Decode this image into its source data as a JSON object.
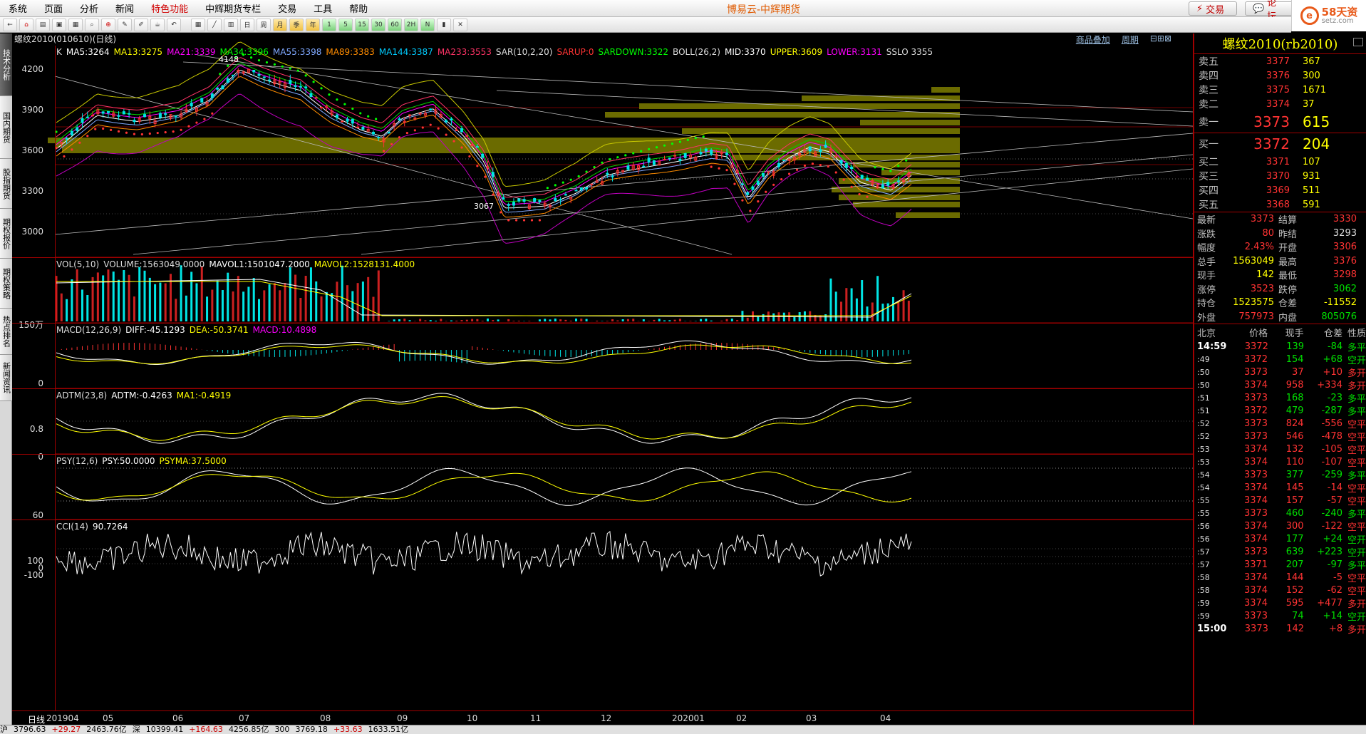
{
  "menu": {
    "items": [
      "系统",
      "页面",
      "分析",
      "新闻",
      "特色功能",
      "中辉期货专栏",
      "交易",
      "工具",
      "帮助"
    ],
    "highlight_index": 4,
    "title": "博易云-中辉期货",
    "trade_label": "交易",
    "forum_label": "论坛"
  },
  "logo": {
    "mark": "e",
    "text1": "58天资",
    "text2": "setz.com"
  },
  "toolbar": {
    "icons": [
      "back-icon",
      "home-icon",
      "book-icon",
      "folder-icon",
      "chart-icon",
      "search-icon",
      "zoom-in-icon",
      "pen-icon",
      "brush-icon",
      "cup-icon",
      "undo-icon",
      "table-icon",
      "line-icon",
      "grid-icon",
      "calendar-icon",
      "week-icon",
      "month-icon",
      "quarter-icon",
      "year-icon",
      "1min-icon",
      "5min-icon",
      "15min-icon",
      "30min-icon",
      "60min-icon",
      "2h-icon",
      "custom-icon",
      "bar-icon",
      "close-icon"
    ],
    "labels": [
      "←",
      "⌂",
      "▤",
      "▣",
      "▦",
      "⌕",
      "⊕",
      "✎",
      "✐",
      "☕",
      "↶",
      "▦",
      "╱",
      "▥",
      "日",
      "周",
      "月",
      "季",
      "年",
      "1",
      "5",
      "15",
      "30",
      "60",
      "2H",
      "N",
      "▮",
      "✕"
    ]
  },
  "sidebar": {
    "tabs": [
      "技术分析",
      "国内期货",
      "股指期货",
      "期权报价",
      "期权策略",
      "热点排名",
      "新闻资讯"
    ],
    "active_index": 0
  },
  "chart": {
    "header": "螺纹2010(010610)(日线)",
    "links": [
      "商品叠加",
      "周期"
    ],
    "xaxis": {
      "label": "日线",
      "ticks": [
        "201904",
        "05",
        "06",
        "07",
        "08",
        "09",
        "10",
        "11",
        "12",
        "202001",
        "02",
        "03",
        "04"
      ]
    },
    "main": {
      "legend": [
        {
          "t": "K",
          "c": "#dddddd"
        },
        {
          "t": "MA5:3264",
          "c": "#ffffff"
        },
        {
          "t": "MA13:3275",
          "c": "#ffff00"
        },
        {
          "t": "MA21:3339",
          "c": "#ff00ff"
        },
        {
          "t": "MA34:3396",
          "c": "#00ff00"
        },
        {
          "t": "MA55:3398",
          "c": "#7fa8ff"
        },
        {
          "t": "MA89:3383",
          "c": "#ff8c00"
        },
        {
          "t": "MA144:3387",
          "c": "#00ccff"
        },
        {
          "t": "MA233:3553",
          "c": "#ff3366"
        },
        {
          "t": "SAR(10,2,20)",
          "c": "#dddddd"
        },
        {
          "t": "SARUP:0",
          "c": "#ff3333"
        },
        {
          "t": "SARDOWN:3322",
          "c": "#00ff00"
        },
        {
          "t": "BOLL(26,2)",
          "c": "#dddddd"
        },
        {
          "t": "MID:3370",
          "c": "#ffffff"
        },
        {
          "t": "UPPER:3609",
          "c": "#ffff00"
        },
        {
          "t": "LOWER:3131",
          "c": "#ff00ff"
        },
        {
          "t": "SSLO 3355",
          "c": "#dddddd"
        }
      ],
      "yticks": [
        "4200",
        "3900",
        "3600",
        "3300",
        "3000"
      ],
      "annotations": [
        "4148",
        "3067"
      ]
    },
    "vol": {
      "legend": [
        {
          "t": "VOL(5,10)",
          "c": "#dddddd"
        },
        {
          "t": "VOLUME:1563049.0000",
          "c": "#dddddd"
        },
        {
          "t": "MAVOL1:1501047.2000",
          "c": "#ffffff"
        },
        {
          "t": "MAVOL2:1528131.4000",
          "c": "#ffff00"
        }
      ],
      "yticks": [
        "150万"
      ]
    },
    "macd": {
      "legend": [
        {
          "t": "MACD(12,26,9)",
          "c": "#dddddd"
        },
        {
          "t": "DIFF:-45.1293",
          "c": "#ffffff"
        },
        {
          "t": "DEA:-50.3741",
          "c": "#ffff00"
        },
        {
          "t": "MACD:10.4898",
          "c": "#ff00ff"
        }
      ],
      "yticks": [
        "0"
      ]
    },
    "adtm": {
      "legend": [
        {
          "t": "ADTM(23,8)",
          "c": "#dddddd"
        },
        {
          "t": "ADTM:-0.4263",
          "c": "#ffffff"
        },
        {
          "t": "MA1:-0.4919",
          "c": "#ffff00"
        }
      ],
      "yticks": [
        "0.8",
        "0"
      ]
    },
    "psy": {
      "legend": [
        {
          "t": "PSY(12,6)",
          "c": "#dddddd"
        },
        {
          "t": "PSY:50.0000",
          "c": "#ffffff"
        },
        {
          "t": "PSYMA:37.5000",
          "c": "#ffff00"
        }
      ],
      "yticks": [
        "60"
      ]
    },
    "cci": {
      "legend": [
        {
          "t": "CCI(14)",
          "c": "#dddddd"
        },
        {
          "t": "90.7264",
          "c": "#ffffff"
        }
      ],
      "yticks": [
        "100",
        "0",
        "-100"
      ]
    }
  },
  "quote": {
    "title": "螺纹2010(rb2010)",
    "asks": [
      {
        "l": "卖五",
        "p": "3377",
        "v": "367"
      },
      {
        "l": "卖四",
        "p": "3376",
        "v": "300"
      },
      {
        "l": "卖三",
        "p": "3375",
        "v": "1671"
      },
      {
        "l": "卖二",
        "p": "3374",
        "v": "37"
      },
      {
        "l": "卖一",
        "p": "3373",
        "v": "615"
      }
    ],
    "bids": [
      {
        "l": "买一",
        "p": "3372",
        "v": "204"
      },
      {
        "l": "买二",
        "p": "3371",
        "v": "107"
      },
      {
        "l": "买三",
        "p": "3370",
        "v": "931"
      },
      {
        "l": "买四",
        "p": "3369",
        "v": "511"
      },
      {
        "l": "买五",
        "p": "3368",
        "v": "591"
      }
    ],
    "stats": [
      {
        "a": "最新",
        "b": "3373",
        "bc": "red",
        "c": "结算",
        "d": "3330",
        "dc": "red"
      },
      {
        "a": "涨跌",
        "b": "80",
        "bc": "red",
        "c": "昨结",
        "d": "3293",
        "dc": "wht"
      },
      {
        "a": "幅度",
        "b": "2.43%",
        "bc": "red",
        "c": "开盘",
        "d": "3306",
        "dc": "red"
      },
      {
        "a": "总手",
        "b": "1563049",
        "bc": "yel",
        "c": "最高",
        "d": "3376",
        "dc": "red"
      },
      {
        "a": "现手",
        "b": "142",
        "bc": "yel",
        "c": "最低",
        "d": "3298",
        "dc": "red"
      },
      {
        "a": "涨停",
        "b": "3523",
        "bc": "red",
        "c": "跌停",
        "d": "3062",
        "dc": "grn"
      },
      {
        "a": "持仓",
        "b": "1523575",
        "bc": "yel",
        "c": "仓差",
        "d": "-11552",
        "dc": "yel"
      },
      {
        "a": "外盘",
        "b": "757973",
        "bc": "red",
        "c": "内盘",
        "d": "805076",
        "dc": "grn"
      }
    ],
    "tick_headers": [
      "北京",
      "价格",
      "现手",
      "仓差",
      "性质"
    ],
    "ticks": [
      {
        "t": "14:59",
        "p": "3372",
        "v": "139",
        "o": "-84",
        "k": "多平",
        "vc": "grn",
        "kc": "grn"
      },
      {
        "t": ":49",
        "p": "3372",
        "v": "154",
        "o": "+68",
        "k": "空开",
        "vc": "grn",
        "kc": "grn"
      },
      {
        "t": ":50",
        "p": "3373",
        "v": "37",
        "o": "+10",
        "k": "多开",
        "vc": "red",
        "kc": "red"
      },
      {
        "t": ":50",
        "p": "3374",
        "v": "958",
        "o": "+334",
        "k": "多开",
        "vc": "red",
        "kc": "red"
      },
      {
        "t": ":51",
        "p": "3373",
        "v": "168",
        "o": "-23",
        "k": "多平",
        "vc": "grn",
        "kc": "grn"
      },
      {
        "t": ":51",
        "p": "3372",
        "v": "479",
        "o": "-287",
        "k": "多平",
        "vc": "grn",
        "kc": "grn"
      },
      {
        "t": ":52",
        "p": "3373",
        "v": "824",
        "o": "-556",
        "k": "空平",
        "vc": "red",
        "kc": "red"
      },
      {
        "t": ":52",
        "p": "3373",
        "v": "546",
        "o": "-478",
        "k": "空平",
        "vc": "red",
        "kc": "red"
      },
      {
        "t": ":53",
        "p": "3374",
        "v": "132",
        "o": "-105",
        "k": "空平",
        "vc": "red",
        "kc": "red"
      },
      {
        "t": ":53",
        "p": "3374",
        "v": "110",
        "o": "-107",
        "k": "空平",
        "vc": "red",
        "kc": "red"
      },
      {
        "t": ":54",
        "p": "3373",
        "v": "377",
        "o": "-259",
        "k": "多平",
        "vc": "grn",
        "kc": "grn"
      },
      {
        "t": ":54",
        "p": "3374",
        "v": "145",
        "o": "-14",
        "k": "空平",
        "vc": "red",
        "kc": "red"
      },
      {
        "t": ":55",
        "p": "3374",
        "v": "157",
        "o": "-57",
        "k": "空平",
        "vc": "red",
        "kc": "red"
      },
      {
        "t": ":55",
        "p": "3373",
        "v": "460",
        "o": "-240",
        "k": "多平",
        "vc": "grn",
        "kc": "grn"
      },
      {
        "t": ":56",
        "p": "3374",
        "v": "300",
        "o": "-122",
        "k": "空平",
        "vc": "red",
        "kc": "red"
      },
      {
        "t": ":56",
        "p": "3374",
        "v": "177",
        "o": "+24",
        "k": "空开",
        "vc": "grn",
        "kc": "grn"
      },
      {
        "t": ":57",
        "p": "3373",
        "v": "639",
        "o": "+223",
        "k": "空开",
        "vc": "grn",
        "kc": "grn"
      },
      {
        "t": ":57",
        "p": "3371",
        "v": "207",
        "o": "-97",
        "k": "多平",
        "vc": "grn",
        "kc": "grn"
      },
      {
        "t": ":58",
        "p": "3374",
        "v": "144",
        "o": "-5",
        "k": "空平",
        "vc": "red",
        "kc": "red"
      },
      {
        "t": ":58",
        "p": "3374",
        "v": "152",
        "o": "-62",
        "k": "空平",
        "vc": "red",
        "kc": "red"
      },
      {
        "t": ":59",
        "p": "3374",
        "v": "595",
        "o": "+477",
        "k": "多开",
        "vc": "red",
        "kc": "red"
      },
      {
        "t": ":59",
        "p": "3373",
        "v": "74",
        "o": "+14",
        "k": "空开",
        "vc": "grn",
        "kc": "grn"
      },
      {
        "t": "15:00",
        "p": "3373",
        "v": "142",
        "o": "+8",
        "k": "多开",
        "vc": "red",
        "kc": "red"
      }
    ]
  },
  "status": [
    "沪",
    "3796.63",
    "+29.27",
    "2463.76亿",
    "深",
    "10399.41",
    "+164.63",
    "4256.85亿",
    "300",
    "3769.18",
    "+33.63",
    "1633.51亿"
  ]
}
